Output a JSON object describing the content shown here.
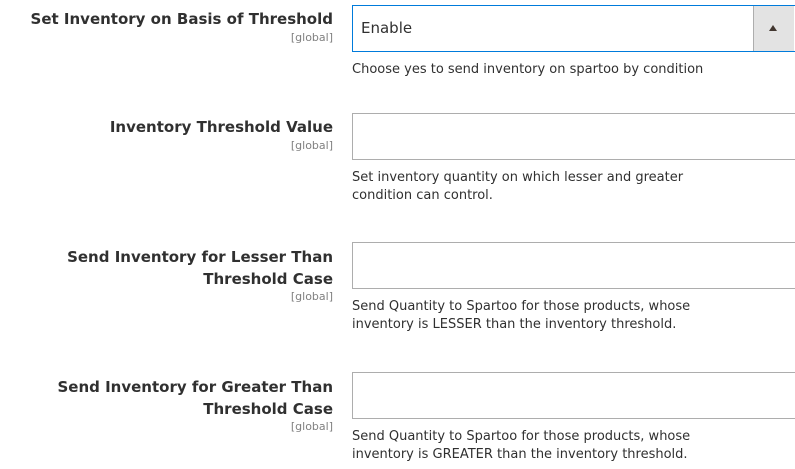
{
  "fields": [
    {
      "label": "Set Inventory on Basis of Threshold",
      "scope": "[global]",
      "value": "Enable",
      "note": "Choose yes to send inventory on spartoo by condition"
    },
    {
      "label": "Inventory Threshold Value",
      "scope": "[global]",
      "value": "",
      "note": "Set inventory quantity on which lesser and greater condition can control."
    },
    {
      "label_line1": "Send Inventory for Lesser Than",
      "label_line2": "Threshold Case",
      "scope": "[global]",
      "value": "",
      "note": "Send Quantity to Spartoo for those products, whose inventory is LESSER than the inventory threshold."
    },
    {
      "label_line1": "Send Inventory for Greater Than",
      "label_line2": "Threshold Case",
      "scope": "[global]",
      "value": "",
      "note": "Send Quantity to Spartoo for those products, whose inventory is GREATER than the inventory threshold."
    }
  ],
  "icons": {
    "select_arrow": "triangle-up-icon"
  },
  "colors": {
    "focus_border": "#007bdb",
    "scope_text": "#808080",
    "arrow_bg": "#e3e3e3"
  }
}
